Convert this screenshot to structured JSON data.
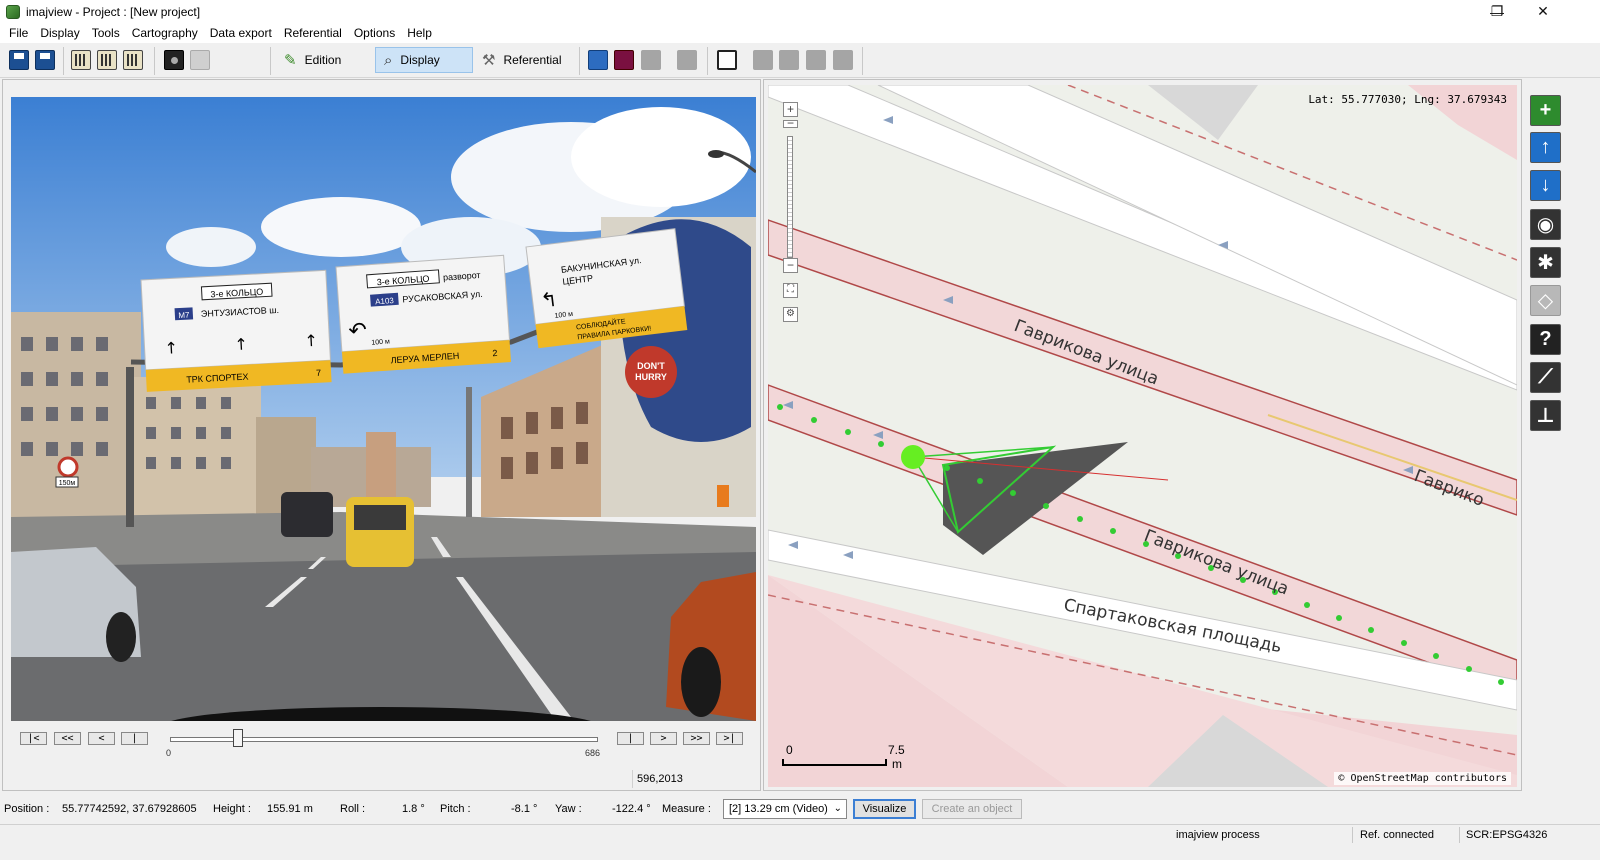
{
  "window": {
    "title": "imajview - Project : [New project]",
    "minimize_glyph": "—",
    "restore_glyph": "❐",
    "close_glyph": "✕"
  },
  "menu": [
    "File",
    "Display",
    "Tools",
    "Cartography",
    "Data export",
    "Referential",
    "Options",
    "Help"
  ],
  "toolbar": {
    "edition_label": "Edition",
    "display_label": "Display",
    "referential_label": "Referential",
    "active_mode": "Display"
  },
  "photo": {
    "signs": {
      "sign1_ring": "3-е КОЛЬЦО",
      "sign1_route": "M7",
      "sign1_text": "ЭНТУЗИАСТОВ ш.",
      "sign1_bottom": "ТРК СПОРТЕХ",
      "sign1_bottom_num": "7",
      "sign2_ring": "3-е КОЛЬЦО",
      "sign2_turn": "разворот",
      "sign2_route": "A103",
      "sign2_text": "РУСАКОВСКАЯ ул.",
      "sign2_dist": "100 м",
      "sign2_bottom": "ЛЕРУА МЕРЛЕН",
      "sign2_bottom_num": "2",
      "sign3_text1": "БАКУНИНСКАЯ ул.",
      "sign3_text2": "ЦЕНТР",
      "sign3_dist": "100 м",
      "sign3_bottom1": "СОБЛЮДАЙТЕ",
      "sign3_bottom2": "ПРАВИЛА ПАРКОВКИ!",
      "mural_text1": "DON'T",
      "mural_text2": "HURRY",
      "speed_sign": "150м"
    }
  },
  "playback": {
    "buttons": [
      "|<",
      "<<",
      "<",
      "|",
      "|",
      ">",
      ">>",
      ">|"
    ],
    "slider_min": "0",
    "slider_max": "686",
    "slider_position": 0.16,
    "frame_info": "596,2013"
  },
  "map": {
    "coords": "Lat: 55.777030; Lng: 37.679343",
    "zoom_in": "+",
    "zoom_out": "−",
    "street1": "Гаврикова улица",
    "street2": "Гаврикова улица",
    "street3": "Спартаковская площадь",
    "street4": "Гаврико",
    "scale_start": "0",
    "scale_end": "7.5",
    "scale_unit": "m",
    "attribution": "© OpenStreetMap contributors"
  },
  "tools": [
    {
      "name": "add-tool",
      "icon": "+",
      "color": "#2e8b2e"
    },
    {
      "name": "up-tool",
      "icon": "↑",
      "color": "#1f6fc8"
    },
    {
      "name": "down-tool",
      "icon": "↓",
      "color": "#1f6fc8"
    },
    {
      "name": "camera-tool",
      "icon": "◉",
      "color": "#333333"
    },
    {
      "name": "eye-tool",
      "icon": "✱",
      "color": "#333333"
    },
    {
      "name": "cone-tool",
      "icon": "◇",
      "color": "#aaaaaa"
    },
    {
      "name": "help-tool",
      "icon": "?",
      "color": "#222222"
    },
    {
      "name": "ruler-tool",
      "icon": "⟋",
      "color": "#333333"
    },
    {
      "name": "height-tool",
      "icon": "⊥",
      "color": "#333333"
    }
  ],
  "status": {
    "position_label": "Position :",
    "position_value": "55.77742592, 37.67928605",
    "height_label": "Height :",
    "height_value": "155.91 m",
    "roll_label": "Roll :",
    "roll_value": "1.8 °",
    "pitch_label": "Pitch :",
    "pitch_value": "-8.1 °",
    "yaw_label": "Yaw :",
    "yaw_value": "-122.4 °",
    "measure_label": "Measure :",
    "measure_value": "[2] 13.29 cm (Video)",
    "visualize_label": "Visualize",
    "create_label": "Create an object"
  },
  "bottom": {
    "process": "imajview process",
    "ref_status": "Ref. connected",
    "scr": "SCR:EPSG4326"
  }
}
